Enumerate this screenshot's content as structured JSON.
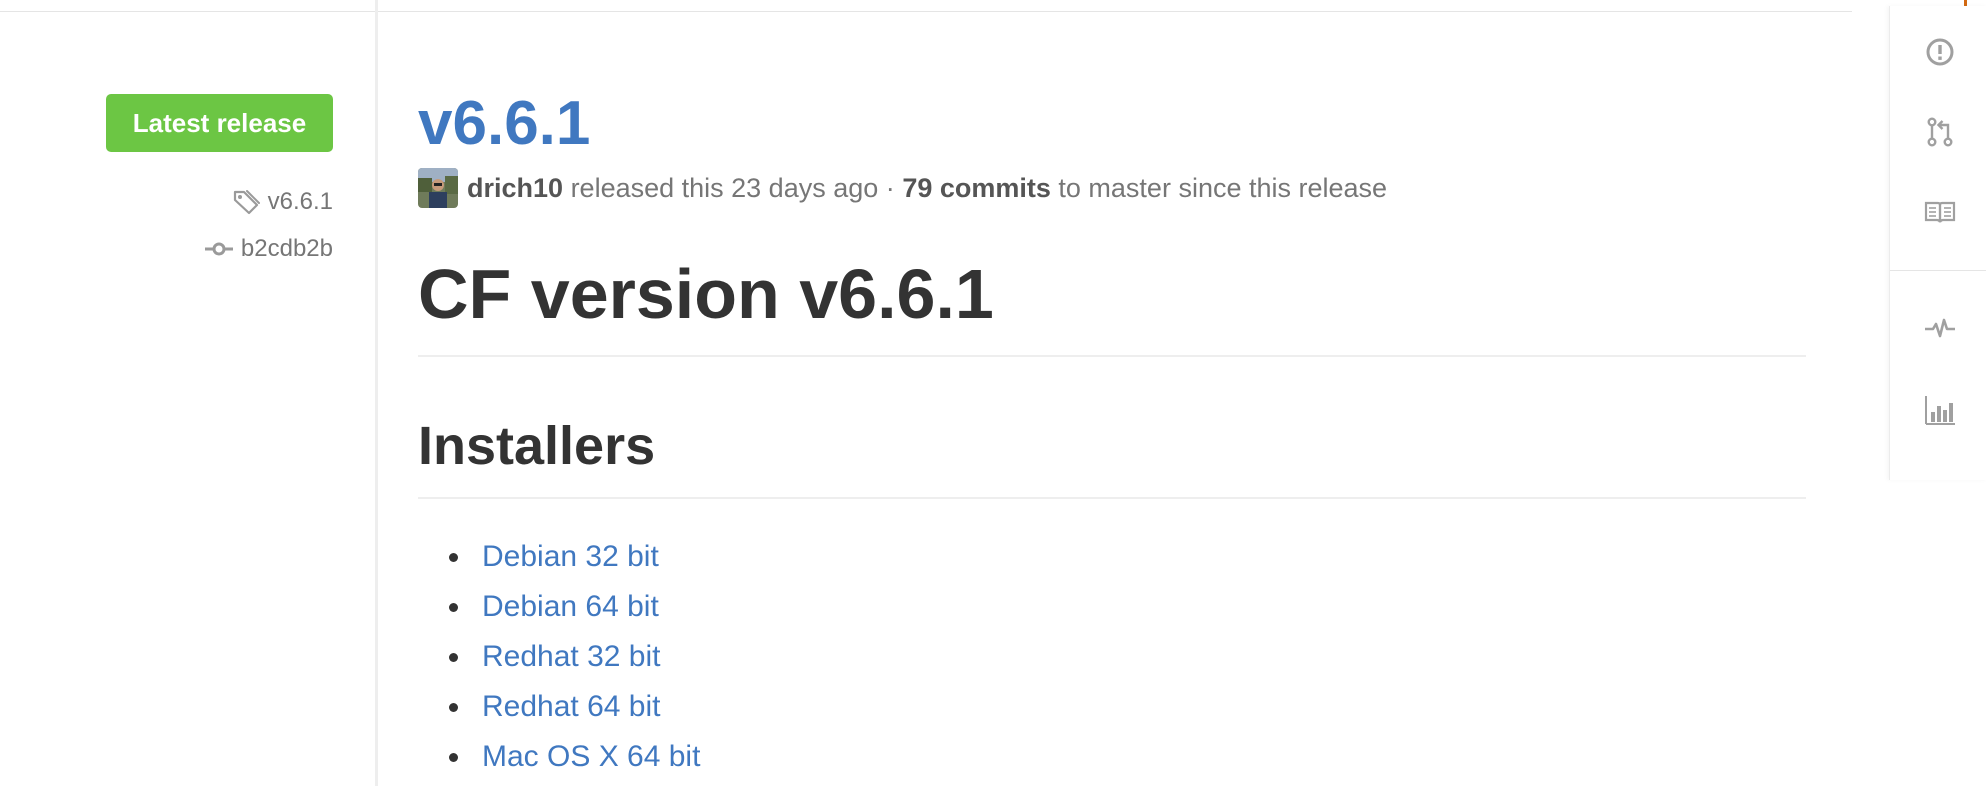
{
  "sidebar": {
    "badge_label": "Latest release",
    "tag_label": "v6.6.1",
    "commit_label": "b2cdb2b"
  },
  "release": {
    "title": "v6.6.1",
    "author": "drich10",
    "released_text": "released this 23 days ago",
    "separator": "·",
    "commits_label": "79 commits",
    "commits_suffix": "to master since this release"
  },
  "body": {
    "heading": "CF version v6.6.1",
    "subheading": "Installers",
    "installers": [
      "Debian 32 bit",
      "Debian 64 bit",
      "Redhat 32 bit",
      "Redhat 64 bit",
      "Mac OS X 64 bit"
    ]
  },
  "repo_nav": {
    "icons": [
      "issues-icon",
      "pull-requests-icon",
      "wiki-icon",
      "pulse-icon",
      "graphs-icon"
    ]
  },
  "colors": {
    "accent_link": "#4078c0",
    "badge_green": "#6cc644",
    "muted_text": "#767676"
  }
}
